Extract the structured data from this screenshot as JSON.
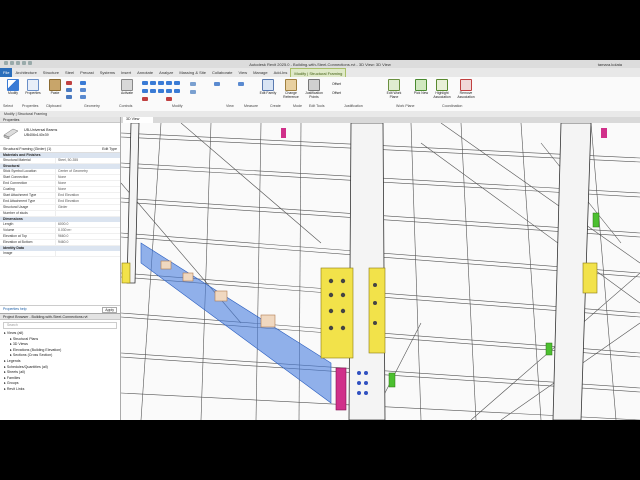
{
  "app": {
    "title": "Autodesk Revit 2025.0 - Building-with-Steel-Connections.rvt - 3D View: 3D View",
    "user": "tamara.kolata"
  },
  "tabs": [
    "File",
    "Architecture",
    "Structure",
    "Steel",
    "Precast",
    "Systems",
    "Insert",
    "Annotate",
    "Analyze",
    "Massing & Site",
    "Collaborate",
    "View",
    "Manage",
    "Add-Ins",
    "Modify | Structural Framing"
  ],
  "ribbon": {
    "buttons": [
      "Modify",
      "Properties",
      "Paste",
      "Join",
      "Activate",
      "Edit Family",
      "Change Reference",
      "Justification Points",
      "Edit Work Plane",
      "Pick New",
      "Highlight Association",
      "Remove Association"
    ],
    "panels": [
      "Select",
      "Properties",
      "Clipboard",
      "Geometry",
      "Controls",
      "Modify",
      "View",
      "Measure",
      "Create",
      "Mode",
      "Edit Tools",
      "Justification",
      "Work Plane",
      "Coordination"
    ],
    "offset_labels": [
      "Offset",
      "Offset"
    ]
  },
  "context_bar": "Modify | Structural Framing",
  "properties": {
    "header": "Properties",
    "type_name_1": "UB-Universal Beams",
    "type_name_2": "UB406x140x39",
    "selector": "Structural Framing (Girder) (1)",
    "edit_type": "Edit Type",
    "categories": [
      {
        "name": "Materials and Finishes",
        "rows": [
          {
            "k": "Structural Material",
            "v": "Steel, 50-355"
          }
        ]
      },
      {
        "name": "Structural",
        "rows": [
          {
            "k": "Stick Symbol Location",
            "v": "Center of Geometry"
          },
          {
            "k": "Start Connection",
            "v": "None"
          },
          {
            "k": "End Connection",
            "v": "None"
          },
          {
            "k": "Coating",
            "v": "None"
          },
          {
            "k": "Start Attachment Type",
            "v": "End Elevation"
          },
          {
            "k": "End Attachment Type",
            "v": "End Elevation"
          },
          {
            "k": "Structural Usage",
            "v": "Girder"
          },
          {
            "k": "Number of studs",
            "v": ""
          }
        ]
      },
      {
        "name": "Dimensions",
        "rows": [
          {
            "k": "Length",
            "v": "6000.0"
          },
          {
            "k": "Volume",
            "v": "0.030 m³"
          },
          {
            "k": "Elevation at Top",
            "v": "9660.0"
          },
          {
            "k": "Elevation at Bottom",
            "v": "9460.0"
          }
        ]
      },
      {
        "name": "Identity Data",
        "rows": [
          {
            "k": "Image",
            "v": ""
          }
        ]
      }
    ],
    "help": "Properties help",
    "apply": "Apply"
  },
  "browser": {
    "header": "Project Browser - Building-with-Steel-Connections.rvt",
    "search_placeholder": "Search",
    "nodes": [
      {
        "label": "Views (all)",
        "indent": 0
      },
      {
        "label": "Structural Plans",
        "indent": 1
      },
      {
        "label": "3D Views",
        "indent": 1
      },
      {
        "label": "Elevations (Building Elevation)",
        "indent": 1
      },
      {
        "label": "Sections (Cross Section)",
        "indent": 1
      },
      {
        "label": "Legends",
        "indent": 0
      },
      {
        "label": "Schedules/Quantities (all)",
        "indent": 0
      },
      {
        "label": "Sheets (all)",
        "indent": 0
      },
      {
        "label": "Families",
        "indent": 0
      },
      {
        "label": "Groups",
        "indent": 0
      },
      {
        "label": "Revit Links",
        "indent": 0
      }
    ]
  },
  "view_tab": "3D View"
}
